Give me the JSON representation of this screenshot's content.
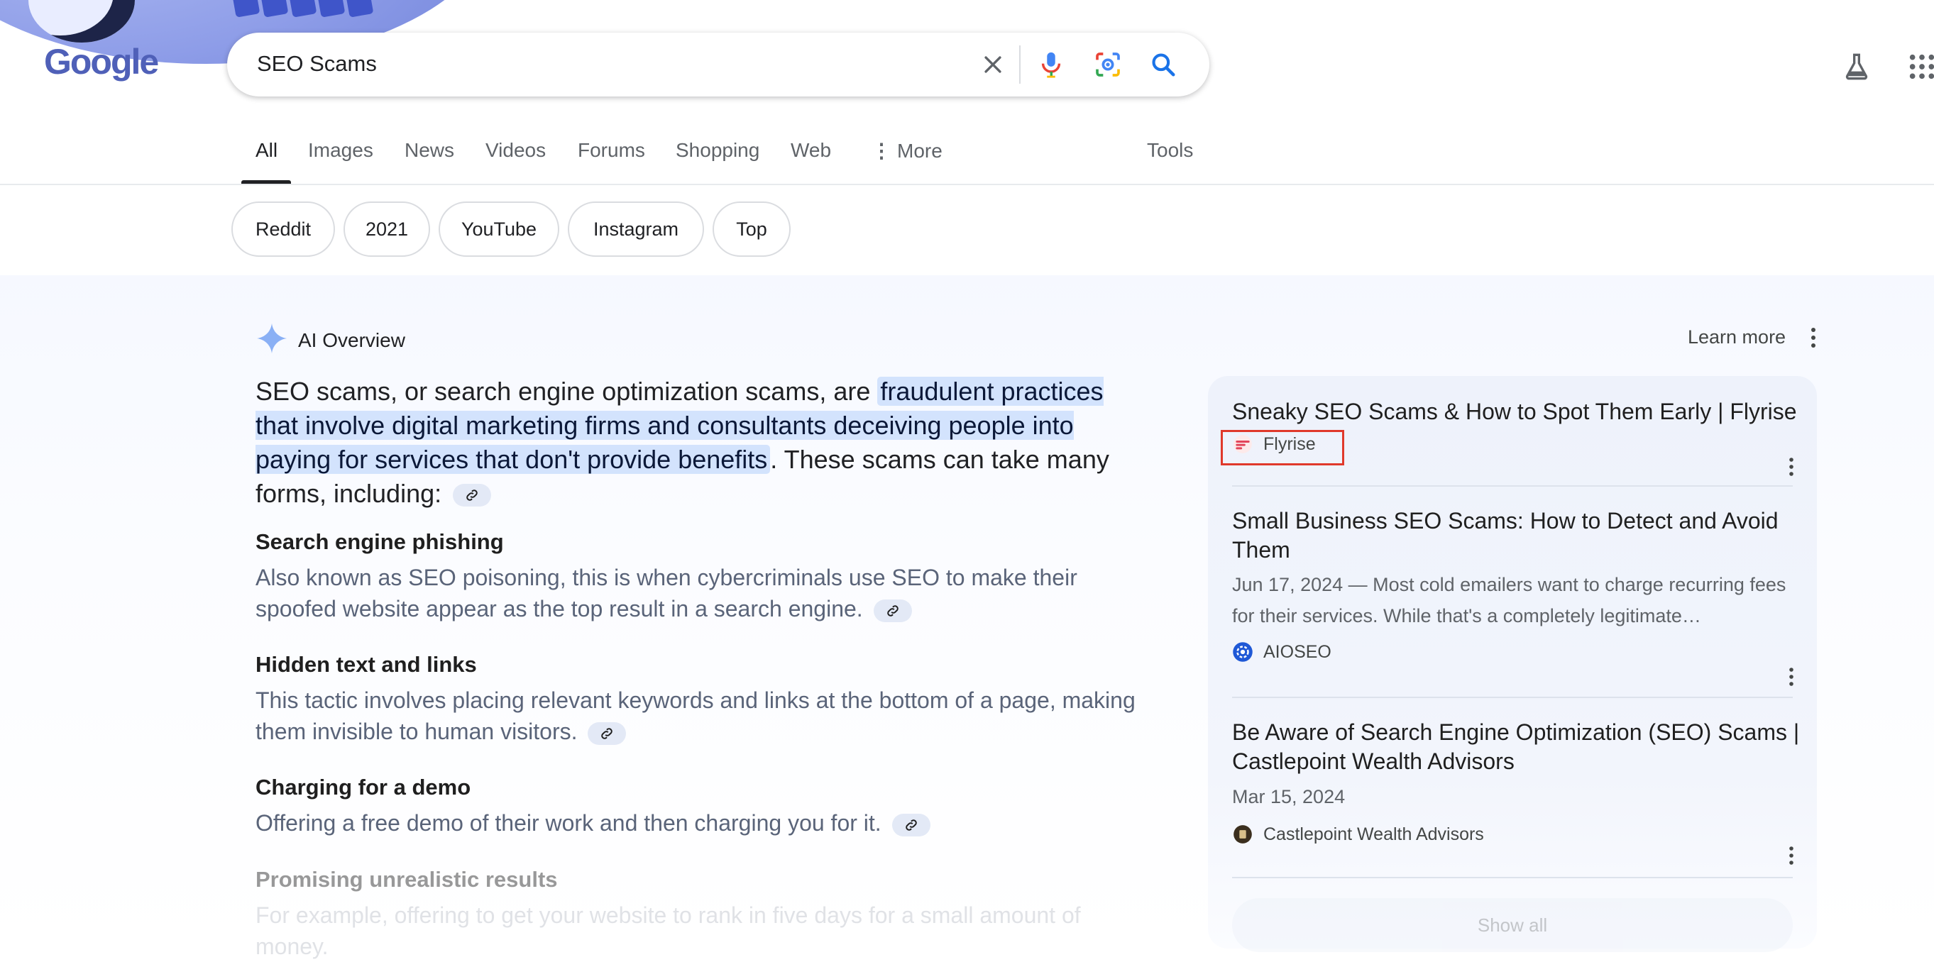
{
  "logo": {
    "text": "Google"
  },
  "search": {
    "query": "SEO Scams"
  },
  "tabs": [
    {
      "label": "All"
    },
    {
      "label": "Images"
    },
    {
      "label": "News"
    },
    {
      "label": "Videos"
    },
    {
      "label": "Forums"
    },
    {
      "label": "Shopping"
    },
    {
      "label": "Web"
    },
    {
      "label": "More"
    }
  ],
  "tools_label": "Tools",
  "chips": [
    "Reddit",
    "2021",
    "YouTube",
    "Instagram",
    "Top"
  ],
  "ai_overview": {
    "title": "AI Overview",
    "learn_more": "Learn more",
    "lead_before": "SEO scams, or search engine optimization scams, are ",
    "lead_highlight": "fraudulent practices that involve digital marketing firms and consultants deceiving people into paying for services that don't provide benefits",
    "lead_after": ". These scams can take many forms, including:",
    "sections": [
      {
        "heading": "Search engine phishing",
        "body": "Also known as SEO poisoning, this is when cybercriminals use SEO to make their spoofed website appear as the top result in a search engine."
      },
      {
        "heading": "Hidden text and links",
        "body": "This tactic involves placing relevant keywords and links at the bottom of a page, making them invisible to human visitors."
      },
      {
        "heading": "Charging for a demo",
        "body": "Offering a free demo of their work and then charging you for it."
      },
      {
        "heading": "Promising unrealistic results",
        "body": "For example, offering to get your website to rank in five days for a small amount of money."
      }
    ]
  },
  "sources": [
    {
      "title": "Sneaky SEO Scams & How to Spot Them Early | Flyrise",
      "site": "Flyrise"
    },
    {
      "title": "Small Business SEO Scams: How to Detect and Avoid Them",
      "date_snippet": "Jun 17, 2024 — Most cold emailers want to charge recurring fees for their services. While that's a completely legitimate…",
      "site": "AIOSEO"
    },
    {
      "title": "Be Aware of Search Engine Optimization (SEO) Scams | Castlepoint Wealth Advisors",
      "date": "Mar 15, 2024",
      "site": "Castlepoint Wealth Advisors"
    }
  ],
  "show_all": "Show all",
  "colors": {
    "accent": "#1a73e8",
    "highlight": "#d3e3fd",
    "annotation_box": "#e0392b"
  }
}
